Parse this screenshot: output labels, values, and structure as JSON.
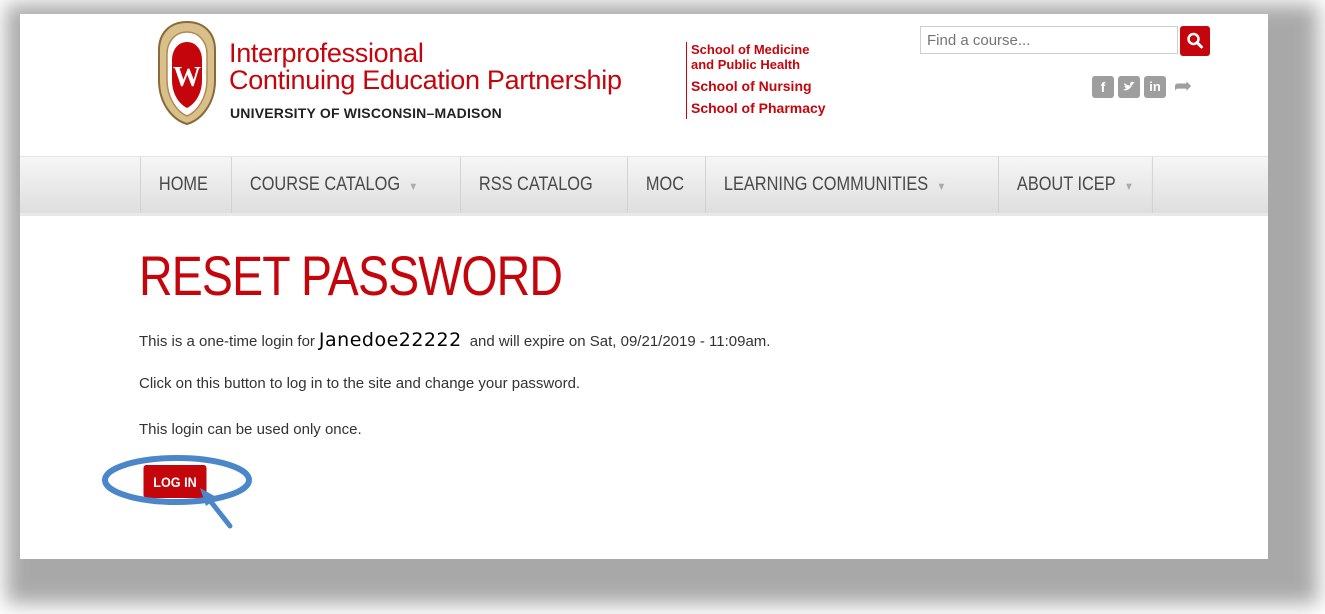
{
  "header": {
    "brand_line1": "Interprofessional",
    "brand_line2": "Continuing Education Partnership",
    "brand_sub": "UNIVERSITY OF WISCONSIN–MADISON",
    "schools": [
      "School of Medicine",
      "and Public Health",
      "School of Nursing",
      "School of Pharmacy"
    ],
    "search_placeholder": "Find a course...",
    "social_icons": [
      "facebook-icon",
      "twitter-icon",
      "linkedin-icon",
      "share-icon"
    ]
  },
  "nav": {
    "items": [
      {
        "label": "HOME",
        "dropdown": false
      },
      {
        "label": "COURSE CATALOG",
        "dropdown": true
      },
      {
        "label": "RSS CATALOG",
        "dropdown": false
      },
      {
        "label": "MOC",
        "dropdown": false
      },
      {
        "label": "LEARNING COMMUNITIES",
        "dropdown": true
      },
      {
        "label": "ABOUT ICEP",
        "dropdown": true
      }
    ]
  },
  "main": {
    "title": "RESET PASSWORD",
    "para1_before": "This is a one-time login for",
    "username": "Janedoe22222",
    "para1_after": "and will expire on Sat, 09/21/2019 - 11:09am.",
    "para2": "Click on this button to log in to the site and change your password.",
    "para3": "This login can be used only once.",
    "login_label": "LOG IN"
  },
  "colors": {
    "brand_red": "#c5050c",
    "annotation_blue": "#4a86c8"
  }
}
